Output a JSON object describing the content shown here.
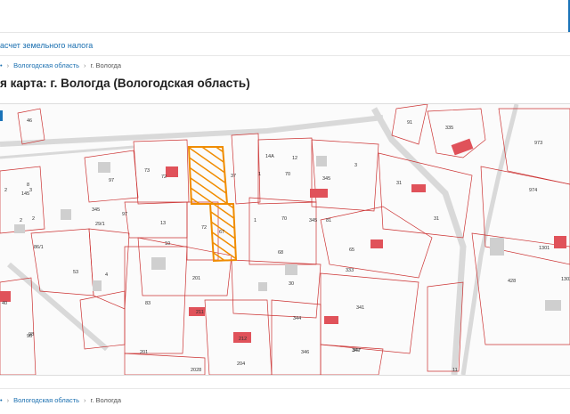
{
  "nav": {
    "land_tax_link": "асчет земельного налога"
  },
  "breadcrumbs_top": {
    "region": "Вологодская область",
    "city": "г. Вологда",
    "separator": "›"
  },
  "page": {
    "heading": "я карта: г. Вологда (Вологодская область)"
  },
  "breadcrumbs_bottom": {
    "region": "Вологодская область",
    "city": "г. Вологда",
    "separator": "›"
  },
  "map": {
    "plot_labels": [
      "46",
      "91",
      "335",
      "973",
      "2",
      "8",
      "3",
      "2",
      "2",
      "73",
      "97",
      "145",
      "72",
      "37",
      "1",
      "70",
      "3",
      "345",
      "31",
      "31",
      "974",
      "98",
      "345",
      "97",
      "13",
      "72",
      "1",
      "70",
      "345",
      "81",
      "29/1",
      "86/1",
      "53",
      "4",
      "10",
      "67",
      "65",
      "68",
      "333",
      "428",
      "1301",
      "1302",
      "201",
      "83",
      "30",
      "341",
      "40",
      "211",
      "344",
      "347",
      "96",
      "201",
      "212",
      "204",
      "346",
      "347",
      "2028",
      "11",
      "14А",
      "12"
    ],
    "highlight_color": "#f08c00",
    "building_color": "#e0525a",
    "boundary_color": "#cc3333"
  }
}
